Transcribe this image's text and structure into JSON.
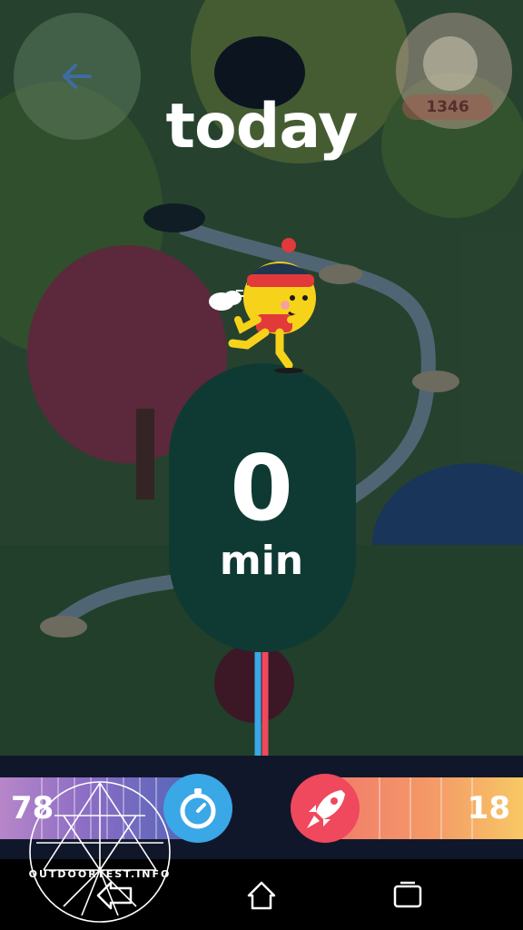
{
  "header": {
    "title": "today",
    "score": "1346"
  },
  "timer": {
    "value": "0",
    "unit": "min"
  },
  "bottom_bar": {
    "left_count": "78",
    "right_count": "18",
    "left_icon": "stopwatch-icon",
    "right_icon": "rocket-icon"
  },
  "nav": {
    "back_icon": "back-icon",
    "home_icon": "home-icon",
    "recents_icon": "recents-icon"
  },
  "watermark": {
    "text": "OUTDOORTEST.INFO"
  },
  "colors": {
    "capsule": "#0f3a33",
    "timer_button": "#3aa7e6",
    "rocket_button": "#f0485c",
    "left_bar_start": "#b786c9",
    "left_bar_end": "#4f66b8",
    "right_bar_start": "#f07a6a",
    "right_bar_end": "#f7c865"
  }
}
